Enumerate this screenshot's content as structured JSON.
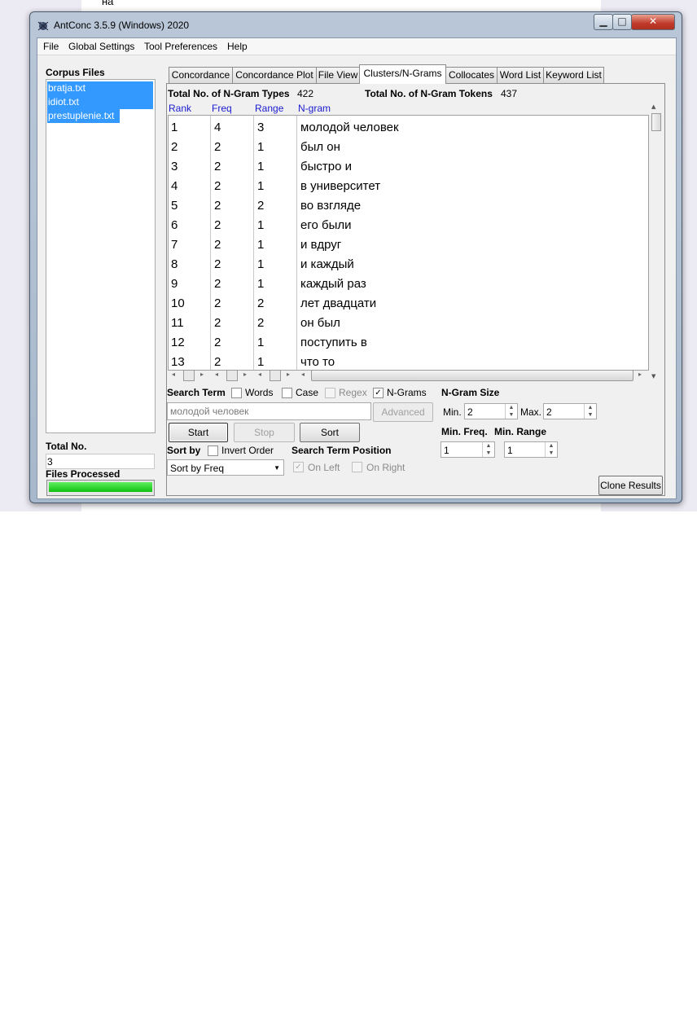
{
  "background_doc": {
    "text": "на"
  },
  "window": {
    "title": "AntConc 3.5.9 (Windows) 2020",
    "controls": {
      "minimize": "▁",
      "maximize": "□",
      "close": "✕"
    }
  },
  "menu": [
    "File",
    "Global Settings",
    "Tool Preferences",
    "Help"
  ],
  "sidebar": {
    "corpus_label": "Corpus Files",
    "files": [
      "bratja.txt",
      "idiot.txt",
      "prestuplenie.txt"
    ],
    "total_label": "Total No.",
    "total_value": "3",
    "processed_label": "Files Processed",
    "progress": 1.0
  },
  "tabs": [
    "Concordance",
    "Concordance Plot",
    "File View",
    "Clusters/N-Grams",
    "Collocates",
    "Word List",
    "Keyword List"
  ],
  "active_tab": "Clusters/N-Grams",
  "stats": {
    "types_label": "Total No. of N-Gram Types",
    "types_value": "422",
    "tokens_label": "Total No. of N-Gram Tokens",
    "tokens_value": "437"
  },
  "columns": [
    "Rank",
    "Freq",
    "Range",
    "N-gram"
  ],
  "rows": [
    [
      "1",
      "4",
      "3",
      "молодой человек"
    ],
    [
      "2",
      "2",
      "1",
      "был он"
    ],
    [
      "3",
      "2",
      "1",
      "быстро и"
    ],
    [
      "4",
      "2",
      "1",
      "в университет"
    ],
    [
      "5",
      "2",
      "2",
      "во взгляде"
    ],
    [
      "6",
      "2",
      "1",
      "его были"
    ],
    [
      "7",
      "2",
      "1",
      "и вдруг"
    ],
    [
      "8",
      "2",
      "1",
      "и каждый"
    ],
    [
      "9",
      "2",
      "1",
      "каждый раз"
    ],
    [
      "10",
      "2",
      "2",
      "лет двадцати"
    ],
    [
      "11",
      "2",
      "2",
      "он был"
    ],
    [
      "12",
      "2",
      "1",
      "поступить в"
    ],
    [
      "13",
      "2",
      "1",
      "что то"
    ]
  ],
  "search": {
    "label": "Search Term",
    "words_label": "Words",
    "case_label": "Case",
    "regex_label": "Regex",
    "ngrams_label": "N-Grams",
    "words_checked": false,
    "case_checked": false,
    "regex_checked": false,
    "ngrams_checked": true,
    "value": "молодой человек",
    "advanced_label": "Advanced"
  },
  "ngram_size": {
    "label": "N-Gram Size",
    "min_label": "Min.",
    "min_value": "2",
    "max_label": "Max.",
    "max_value": "2"
  },
  "buttons": {
    "start": "Start",
    "stop": "Stop",
    "sort": "Sort",
    "clone": "Clone Results"
  },
  "sort": {
    "label": "Sort by",
    "invert_label": "Invert Order",
    "selected": "Sort by Freq"
  },
  "position": {
    "label": "Search Term Position",
    "left_label": "On Left",
    "right_label": "On Right",
    "left_checked": true,
    "right_checked": false
  },
  "min_freq": {
    "label": "Min. Freq.",
    "value": "1"
  },
  "min_range": {
    "label": "Min. Range",
    "value": "1"
  }
}
